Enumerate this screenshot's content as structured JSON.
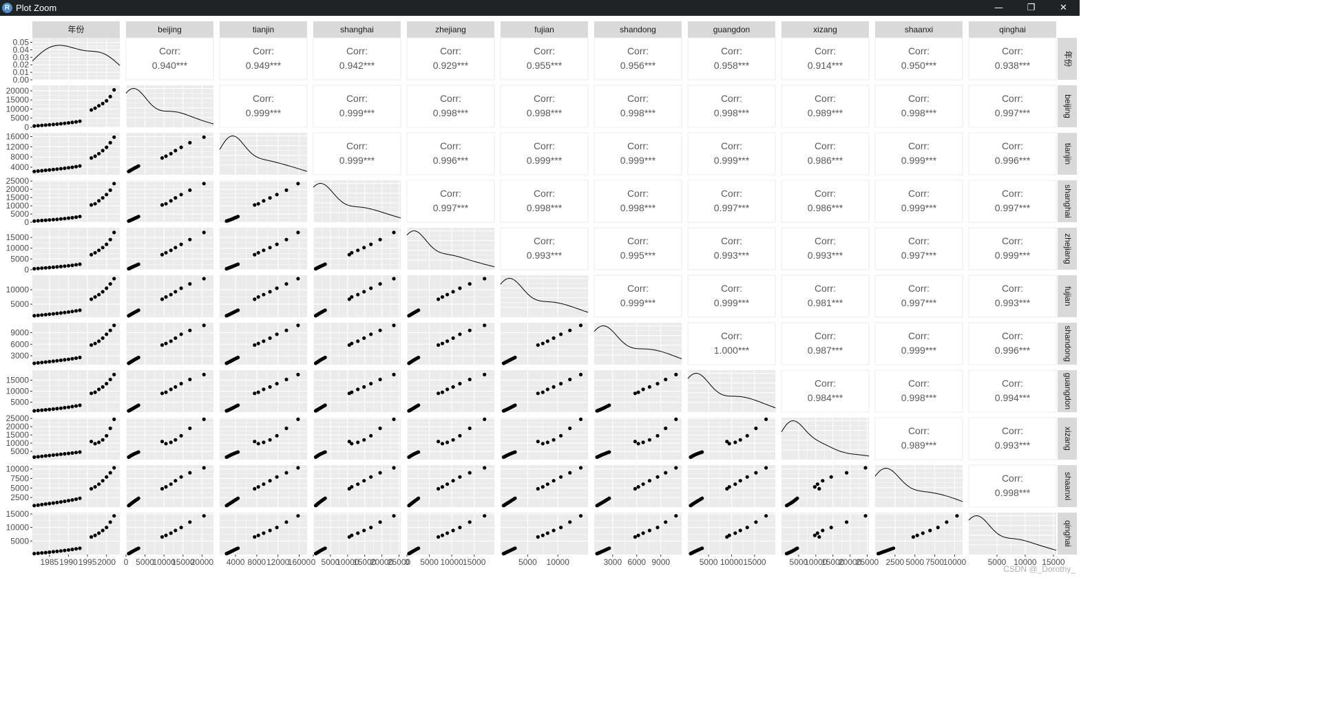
{
  "window": {
    "title": "Plot Zoom",
    "icon_letter": "R",
    "icon_name": "r-app-icon",
    "controls": [
      {
        "name": "minimize-button",
        "glyph": "—"
      },
      {
        "name": "restore-button",
        "glyph": "❐"
      },
      {
        "name": "close-button",
        "glyph": "✕"
      }
    ]
  },
  "watermark": "CSDN @_Dorothy_",
  "colors": {
    "titlebar": "#1f2326",
    "strip": "#d9d9d9",
    "panel_bg": "#ebebeb",
    "grid_major": "#ffffff",
    "corr_text": "#595959",
    "points": "#000000"
  },
  "chart_data": {
    "type": "scatter",
    "subtype": "pair-plot matrix (ggpairs)",
    "variables": [
      "年份",
      "beijing",
      "tianjin",
      "shanghai",
      "zhejiang",
      "fujian",
      "shandong",
      "guangdon",
      "xizang",
      "shaanxi",
      "qinghai"
    ],
    "upper_label": "Corr:",
    "correlations": [
      {
        "row": "年份",
        "values": [
          "0.940***",
          "0.949***",
          "0.942***",
          "0.929***",
          "0.955***",
          "0.956***",
          "0.958***",
          "0.914***",
          "0.950***",
          "0.938***"
        ]
      },
      {
        "row": "beijing",
        "values": [
          "0.999***",
          "0.999***",
          "0.998***",
          "0.998***",
          "0.998***",
          "0.998***",
          "0.989***",
          "0.998***",
          "0.997***"
        ]
      },
      {
        "row": "tianjin",
        "values": [
          "0.999***",
          "0.996***",
          "0.999***",
          "0.999***",
          "0.999***",
          "0.986***",
          "0.999***",
          "0.996***"
        ]
      },
      {
        "row": "shanghai",
        "values": [
          "0.997***",
          "0.998***",
          "0.998***",
          "0.997***",
          "0.986***",
          "0.999***",
          "0.997***"
        ]
      },
      {
        "row": "zhejiang",
        "values": [
          "0.993***",
          "0.995***",
          "0.993***",
          "0.993***",
          "0.997***",
          "0.999***"
        ]
      },
      {
        "row": "fujian",
        "values": [
          "0.999***",
          "0.999***",
          "0.981***",
          "0.997***",
          "0.993***"
        ]
      },
      {
        "row": "shandong",
        "values": [
          "1.000***",
          "0.987***",
          "0.999***",
          "0.996***"
        ]
      },
      {
        "row": "guangdon",
        "values": [
          "0.984***",
          "0.998***",
          "0.994***"
        ]
      },
      {
        "row": "xizang",
        "values": [
          "0.989***",
          "0.993***"
        ]
      },
      {
        "row": "shaanxi",
        "values": [
          "0.998***"
        ]
      }
    ],
    "y_axes": [
      {
        "var": "年份",
        "range": [
          0,
          0.056
        ],
        "ticks": [
          0.0,
          0.01,
          0.02,
          0.03,
          0.04,
          0.05
        ],
        "labels": [
          "0.00",
          "0.01",
          "0.02",
          "0.03",
          "0.04",
          "0.05"
        ]
      },
      {
        "var": "beijing",
        "range": [
          0,
          23000
        ],
        "ticks": [
          0,
          5000,
          10000,
          15000,
          20000
        ],
        "labels": [
          "0",
          "5000",
          "10000",
          "15000",
          "20000"
        ]
      },
      {
        "var": "tianjin",
        "range": [
          1000,
          17500
        ],
        "ticks": [
          4000,
          8000,
          12000,
          16000
        ],
        "labels": [
          "4000",
          "8000",
          "12000",
          "16000"
        ]
      },
      {
        "var": "shanghai",
        "range": [
          0,
          25500
        ],
        "ticks": [
          0,
          5000,
          10000,
          15000,
          20000,
          25000
        ],
        "labels": [
          "0",
          "5000",
          "10000",
          "15000",
          "20000",
          "25000"
        ]
      },
      {
        "var": "zhejiang",
        "range": [
          0,
          19500
        ],
        "ticks": [
          0,
          5000,
          10000,
          15000
        ],
        "labels": [
          "0",
          "5000",
          "10000",
          "15000"
        ]
      },
      {
        "var": "fujian",
        "range": [
          500,
          15000
        ],
        "ticks": [
          5000,
          10000
        ],
        "labels": [
          "5000",
          "10000"
        ]
      },
      {
        "var": "shandong",
        "range": [
          700,
          11600
        ],
        "ticks": [
          3000,
          6000,
          9000
        ],
        "labels": [
          "3000",
          "6000",
          "9000"
        ]
      },
      {
        "var": "guangdon",
        "range": [
          500,
          19500
        ],
        "ticks": [
          5000,
          10000,
          15000
        ],
        "labels": [
          "5000",
          "10000",
          "15000"
        ]
      },
      {
        "var": "xizang",
        "range": [
          0,
          25500
        ],
        "ticks": [
          5000,
          10000,
          15000,
          20000,
          25000
        ],
        "labels": [
          "5000",
          "10000",
          "15000",
          "20000",
          "25000"
        ]
      },
      {
        "var": "shaanxi",
        "range": [
          0,
          11000
        ],
        "ticks": [
          2500,
          5000,
          7500,
          10000
        ],
        "labels": [
          "2500",
          "5000",
          "7500",
          "10000"
        ]
      },
      {
        "var": "qinghai",
        "range": [
          0,
          15500
        ],
        "ticks": [
          5000,
          10000,
          15000
        ],
        "labels": [
          "5000",
          "10000",
          "15000"
        ]
      }
    ],
    "x_axes": [
      {
        "var": "年份",
        "range": [
          1980.5,
          2003.5
        ],
        "ticks": [
          1985,
          1990,
          1995,
          2000
        ],
        "labels": [
          "1985",
          "1990",
          "1995",
          "2000"
        ]
      },
      {
        "var": "beijing",
        "range": [
          0,
          23000
        ],
        "ticks": [
          0,
          5000,
          10000,
          15000,
          20000
        ],
        "labels": [
          "0",
          "5000",
          "10000",
          "15000",
          "20000"
        ]
      },
      {
        "var": "tianjin",
        "range": [
          1000,
          17500
        ],
        "ticks": [
          4000,
          8000,
          12000,
          16000
        ],
        "labels": [
          "4000",
          "8000",
          "12000",
          "16000"
        ]
      },
      {
        "var": "shanghai",
        "range": [
          0,
          25500
        ],
        "ticks": [
          0,
          5000,
          10000,
          15000,
          20000,
          25000
        ],
        "labels": [
          "0",
          "5000",
          "10000",
          "15000",
          "20000",
          "25000"
        ]
      },
      {
        "var": "zhejiang",
        "range": [
          0,
          19500
        ],
        "ticks": [
          0,
          5000,
          10000,
          15000
        ],
        "labels": [
          "0",
          "5000",
          "10000",
          "15000"
        ]
      },
      {
        "var": "fujian",
        "range": [
          500,
          15000
        ],
        "ticks": [
          5000,
          10000
        ],
        "labels": [
          "5000",
          "10000"
        ]
      },
      {
        "var": "shandong",
        "range": [
          700,
          11600
        ],
        "ticks": [
          3000,
          6000,
          9000
        ],
        "labels": [
          "3000",
          "6000",
          "9000"
        ]
      },
      {
        "var": "guangdon",
        "range": [
          500,
          19500
        ],
        "ticks": [
          5000,
          10000,
          15000
        ],
        "labels": [
          "5000",
          "10000",
          "15000"
        ]
      },
      {
        "var": "xizang",
        "range": [
          0,
          25500
        ],
        "ticks": [
          5000,
          10000,
          15000,
          20000,
          25000
        ],
        "labels": [
          "5000",
          "10000",
          "15000",
          "20000",
          "25000"
        ]
      },
      {
        "var": "shaanxi",
        "range": [
          0,
          11000
        ],
        "ticks": [
          2500,
          5000,
          7500,
          10000
        ],
        "labels": [
          "2500",
          "5000",
          "7500",
          "10000"
        ]
      },
      {
        "var": "qinghai",
        "range": [
          0,
          15500
        ],
        "ticks": [
          5000,
          10000,
          15000
        ],
        "labels": [
          "5000",
          "10000",
          "15000"
        ]
      }
    ],
    "observations": [
      {
        "年份": 1981,
        "beijing": 700,
        "tianjin": 2300,
        "shanghai": 700,
        "zhejiang": 450,
        "fujian": 1000,
        "shandong": 1050,
        "guangdon": 1100,
        "xizang": 1500,
        "shaanxi": 400,
        "qinghai": 350
      },
      {
        "年份": 1982,
        "beijing": 870,
        "tianjin": 2450,
        "shanghai": 860,
        "zhejiang": 580,
        "fujian": 1130,
        "shandong": 1160,
        "guangdon": 1250,
        "xizang": 1750,
        "shaanxi": 530,
        "qinghai": 480
      },
      {
        "年份": 1983,
        "beijing": 1040,
        "tianjin": 2600,
        "shanghai": 1030,
        "zhejiang": 720,
        "fujian": 1260,
        "shandong": 1270,
        "guangdon": 1400,
        "xizang": 2000,
        "shaanxi": 660,
        "qinghai": 610
      },
      {
        "年份": 1984,
        "beijing": 1210,
        "tianjin": 2750,
        "shanghai": 1200,
        "zhejiang": 860,
        "fujian": 1390,
        "shandong": 1380,
        "guangdon": 1560,
        "xizang": 2250,
        "shaanxi": 790,
        "qinghai": 740
      },
      {
        "年份": 1985,
        "beijing": 1380,
        "tianjin": 2900,
        "shanghai": 1380,
        "zhejiang": 1000,
        "fujian": 1520,
        "shandong": 1490,
        "guangdon": 1730,
        "xizang": 2500,
        "shaanxi": 920,
        "qinghai": 880
      },
      {
        "年份": 1986,
        "beijing": 1560,
        "tianjin": 3060,
        "shanghai": 1570,
        "zhejiang": 1150,
        "fujian": 1660,
        "shandong": 1600,
        "guangdon": 1900,
        "xizang": 2750,
        "shaanxi": 1060,
        "qinghai": 1030
      },
      {
        "年份": 1987,
        "beijing": 1750,
        "tianjin": 3220,
        "shanghai": 1770,
        "zhejiang": 1310,
        "fujian": 1810,
        "shandong": 1720,
        "guangdon": 2090,
        "xizang": 3000,
        "shaanxi": 1210,
        "qinghai": 1190
      },
      {
        "年份": 1988,
        "beijing": 1960,
        "tianjin": 3390,
        "shanghai": 1990,
        "zhejiang": 1480,
        "fujian": 1960,
        "shandong": 1840,
        "guangdon": 2290,
        "xizang": 3250,
        "shaanxi": 1360,
        "qinghai": 1350
      },
      {
        "年份": 1989,
        "beijing": 2180,
        "tianjin": 3570,
        "shanghai": 2230,
        "zhejiang": 1660,
        "fujian": 2120,
        "shandong": 1970,
        "guangdon": 2510,
        "xizang": 3500,
        "shaanxi": 1520,
        "qinghai": 1520
      },
      {
        "年份": 1990,
        "beijing": 2420,
        "tianjin": 3760,
        "shanghai": 2490,
        "zhejiang": 1850,
        "fujian": 2290,
        "shandong": 2100,
        "guangdon": 2750,
        "xizang": 3750,
        "shaanxi": 1690,
        "qinghai": 1700
      },
      {
        "年份": 1991,
        "beijing": 2680,
        "tianjin": 3960,
        "shanghai": 2770,
        "zhejiang": 2060,
        "fujian": 2470,
        "shandong": 2240,
        "guangdon": 3010,
        "xizang": 4000,
        "shaanxi": 1870,
        "qinghai": 1900
      },
      {
        "年份": 1992,
        "beijing": 2980,
        "tianjin": 4200,
        "shanghai": 3100,
        "zhejiang": 2300,
        "fujian": 2680,
        "shandong": 2400,
        "guangdon": 3300,
        "xizang": 4300,
        "shaanxi": 2080,
        "qinghai": 2120
      },
      {
        "年份": 1993,
        "beijing": 3300,
        "tianjin": 4450,
        "shanghai": 3450,
        "zhejiang": 2560,
        "fujian": 2900,
        "shandong": 2570,
        "guangdon": 3600,
        "xizang": 4600,
        "shaanxi": 2300,
        "qinghai": 2350
      },
      {
        "年份": 1996,
        "beijing": 9500,
        "tianjin": 7600,
        "shanghai": 10500,
        "zhejiang": 7000,
        "fujian": 6700,
        "shandong": 5800,
        "guangdon": 9000,
        "xizang": 11000,
        "shaanxi": 4800,
        "qinghai": 6500
      },
      {
        "年份": 1997,
        "beijing": 10500,
        "tianjin": 8300,
        "shanghai": 11200,
        "zhejiang": 7900,
        "fujian": 7500,
        "shandong": 6200,
        "guangdon": 9500,
        "xizang": 9700,
        "shaanxi": 5300,
        "qinghai": 7100
      },
      {
        "年份": 1998,
        "beijing": 11800,
        "tianjin": 9300,
        "shanghai": 13000,
        "zhejiang": 9000,
        "fujian": 8300,
        "shandong": 6800,
        "guangdon": 10800,
        "xizang": 10500,
        "shaanxi": 6000,
        "qinghai": 7900
      },
      {
        "年份": 1999,
        "beijing": 13000,
        "tianjin": 10500,
        "shanghai": 14800,
        "zhejiang": 10300,
        "fujian": 9300,
        "shandong": 7600,
        "guangdon": 11900,
        "xizang": 12000,
        "shaanxi": 6900,
        "qinghai": 8900
      },
      {
        "年份": 2000,
        "beijing": 14500,
        "tianjin": 11800,
        "shanghai": 16800,
        "zhejiang": 11800,
        "fujian": 10500,
        "shandong": 8600,
        "guangdon": 13400,
        "xizang": 14500,
        "shaanxi": 7900,
        "qinghai": 10000
      },
      {
        "年份": 2001,
        "beijing": 16800,
        "tianjin": 13600,
        "shanghai": 19500,
        "zhejiang": 14000,
        "fujian": 12000,
        "shandong": 9600,
        "guangdon": 15300,
        "xizang": 19000,
        "shaanxi": 9000,
        "qinghai": 12000
      },
      {
        "年份": 2002,
        "beijing": 20500,
        "tianjin": 15800,
        "shanghai": 23500,
        "zhejiang": 17300,
        "fujian": 13800,
        "shandong": 10900,
        "guangdon": 17500,
        "xizang": 24500,
        "shaanxi": 10300,
        "qinghai": 14300
      }
    ]
  }
}
